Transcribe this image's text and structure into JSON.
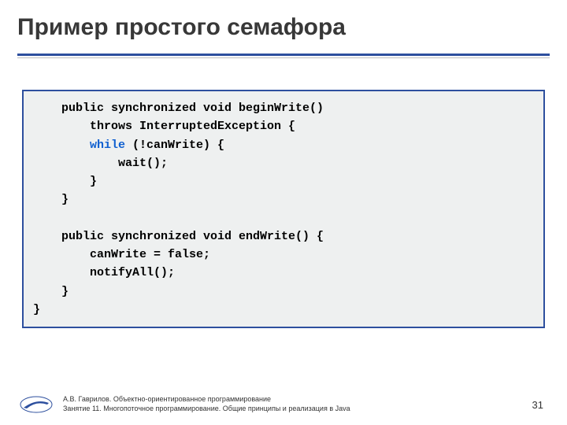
{
  "title": "Пример простого семафора",
  "code": {
    "l1a": "    public synchronized void beginWrite()",
    "l2a": "        throws InterruptedException {",
    "l3a": "        ",
    "l3b": "while",
    "l3c": " (!canWrite) {",
    "l4a": "            wait();",
    "l5a": "        }",
    "l6a": "    }",
    "l7a": "",
    "l8a": "    public synchronized void endWrite() {",
    "l9a": "        canWrite = false;",
    "l10a": "        notifyAll();",
    "l11a": "    }",
    "l12a": "}"
  },
  "footer": {
    "line1": "А.В. Гаврилов. Объектно-ориентированное программирование",
    "line2": "Занятие 11. Многопоточное программирование. Общие принципы и реализация в Java"
  },
  "page": "31"
}
